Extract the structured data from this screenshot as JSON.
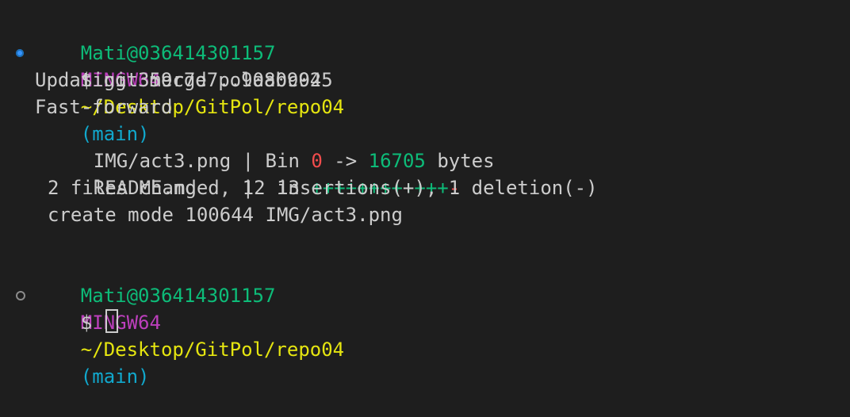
{
  "prompt1": {
    "user_host": "Mati@036414301157",
    "shell": "MINGW64",
    "path": "~/Desktop/GitPol/repo04",
    "branch": "(main)"
  },
  "command": {
    "symbol": "$",
    "text": "git merge pol0809025"
  },
  "output": {
    "updating": "Updating 359c7d7..9aabc94",
    "fast_forward": "Fast-forward",
    "file1": {
      "name": "IMG/act3.png",
      "sep": "|",
      "bin_label": "Bin",
      "old_bytes": "0",
      "arrow": "->",
      "new_bytes": "16705",
      "unit": "bytes"
    },
    "file2": {
      "name": "README.md",
      "sep": "|",
      "changes": "13",
      "plus": "++++++++++++",
      "minus": "-"
    },
    "summary": "2 files changed, 12 insertions(+), 1 deletion(-)",
    "create_mode": "create mode 100644 IMG/act3.png"
  },
  "prompt2": {
    "user_host": "Mati@036414301157",
    "shell": "MINGW64",
    "path": "~/Desktop/GitPol/repo04",
    "branch": "(main)"
  },
  "current": {
    "symbol": "$"
  }
}
